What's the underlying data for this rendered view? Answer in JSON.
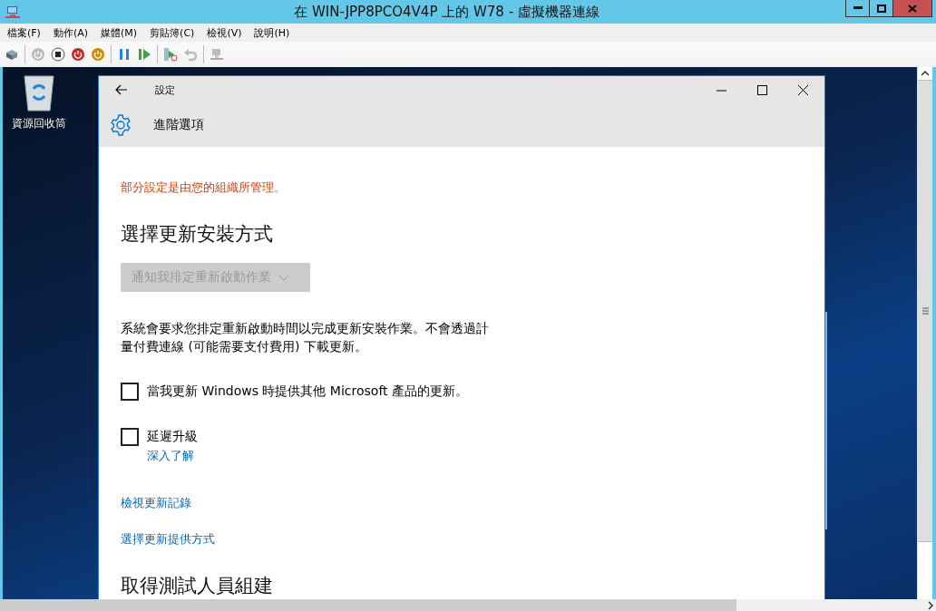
{
  "window": {
    "title": "在 WIN-JPP8PCO4V4P 上的 W78 - 虛擬機器連線"
  },
  "menu": [
    "檔案(F)",
    "動作(A)",
    "媒體(M)",
    "剪貼簿(C)",
    "檢視(V)",
    "說明(H)"
  ],
  "desktop": {
    "icons": [
      {
        "label": "資源回收筒"
      }
    ]
  },
  "settings_window": {
    "title": "設定",
    "page_title": "進階選項",
    "notice": "部分設定是由您的組織所管理。",
    "section_title": "選擇更新安裝方式",
    "install_dropdown": {
      "value": "通知我排定重新啟動作業",
      "disabled": true
    },
    "description": "系統會要求您排定重新啟動時間以完成更新安裝作業。不會透過計量付費連線 (可能需要支付費用) 下載更新。",
    "options": [
      {
        "label": "當我更新 Windows 時提供其他 Microsoft 產品的更新。",
        "checked": false
      },
      {
        "label": "延遲升級",
        "checked": false,
        "link": "深入了解"
      }
    ],
    "links": [
      "檢視更新記錄",
      "選擇更新提供方式"
    ],
    "section_title_2": "取得測試人員組建"
  }
}
